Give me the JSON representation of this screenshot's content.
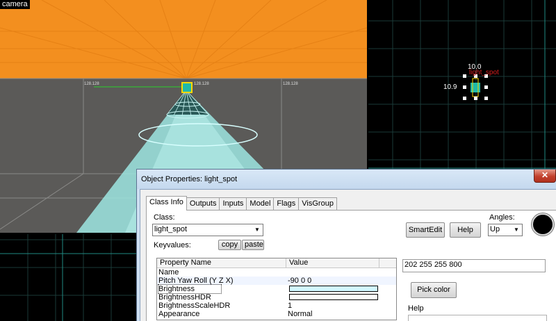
{
  "viewports": {
    "camera": {
      "label": "camera",
      "markers": [
        "128.128",
        "128.128",
        "128.128"
      ],
      "colors": {
        "ceiling": "#f38f1f",
        "floor": "#5b5a58",
        "cone": "#9ee6e2"
      }
    },
    "ortho_top_right": {
      "entity_name": "light_spot",
      "width_readout": "10.0",
      "height_readout": "10.9",
      "colors": {
        "grid": "#0a4f4a",
        "entity": "#1fb9a9",
        "name": "#d61e1e"
      }
    },
    "ortho_bottom_left": {
      "colors": {
        "grid": "#0a4f4a"
      }
    }
  },
  "dialog": {
    "title": "Object Properties: light_spot",
    "close_glyph": "✕",
    "tabs": [
      {
        "label": "Class Info",
        "active": true
      },
      {
        "label": "Outputs",
        "active": false
      },
      {
        "label": "Inputs",
        "active": false
      },
      {
        "label": "Model",
        "active": false
      },
      {
        "label": "Flags",
        "active": false
      },
      {
        "label": "VisGroup",
        "active": false
      }
    ],
    "class_label": "Class:",
    "class_value": "light_spot",
    "keyvalues_label": "Keyvalues:",
    "copy_label": "copy",
    "paste_label": "paste",
    "smartedit_label": "SmartEdit",
    "help_button_label": "Help",
    "angles_label": "Angles:",
    "angles_value": "Up",
    "table": {
      "columns": [
        "Property Name",
        "Value"
      ],
      "rows": [
        {
          "name": "Name",
          "value": ""
        },
        {
          "name": "Pitch Yaw Roll (Y Z X)",
          "value": "-90 0 0"
        },
        {
          "name": "Brightness",
          "value": "",
          "swatch": "#d2f8ff",
          "selected": true
        },
        {
          "name": "BrightnessHDR",
          "value": "",
          "swatch": "#ffffff"
        },
        {
          "name": "BrightnessScaleHDR",
          "value": "1"
        },
        {
          "name": "Appearance",
          "value": "Normal"
        }
      ]
    },
    "value_field": "202 255 255 800",
    "pick_color_label": "Pick color",
    "help_section_label": "Help"
  }
}
